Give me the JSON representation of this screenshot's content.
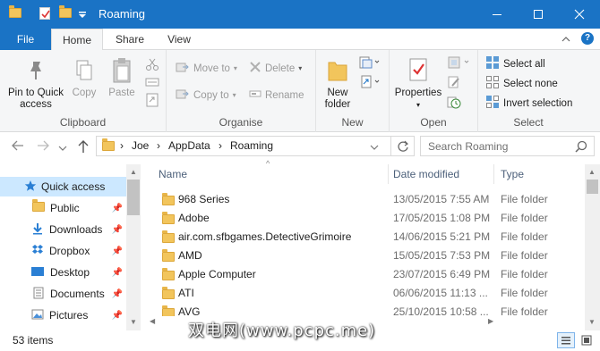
{
  "window": {
    "title": "Roaming"
  },
  "ribbon_tabs": [
    "File",
    "Home",
    "Share",
    "View"
  ],
  "clipboard": {
    "pin_label": "Pin to Quick access",
    "copy_label": "Copy",
    "paste_label": "Paste",
    "group_label": "Clipboard"
  },
  "organise": {
    "move_to": "Move to",
    "copy_to": "Copy to",
    "delete": "Delete",
    "rename": "Rename",
    "group_label": "Organise"
  },
  "new_group": {
    "new_folder": "New folder",
    "group_label": "New"
  },
  "open_group": {
    "properties": "Properties",
    "group_label": "Open"
  },
  "select_group": {
    "select_all": "Select all",
    "select_none": "Select none",
    "invert": "Invert selection",
    "group_label": "Select"
  },
  "address": {
    "crumbs": [
      "Joe",
      "AppData",
      "Roaming"
    ],
    "search_placeholder": "Search Roaming"
  },
  "sidebar": {
    "items": [
      {
        "label": "Quick access",
        "icon": "star-icon",
        "pinned": false
      },
      {
        "label": "Public",
        "icon": "folder-icon",
        "pinned": true
      },
      {
        "label": "Downloads",
        "icon": "download-icon",
        "pinned": true
      },
      {
        "label": "Dropbox",
        "icon": "dropbox-icon",
        "pinned": true
      },
      {
        "label": "Desktop",
        "icon": "desktop-icon",
        "pinned": true
      },
      {
        "label": "Documents",
        "icon": "documents-icon",
        "pinned": true
      },
      {
        "label": "Pictures",
        "icon": "pictures-icon",
        "pinned": true
      }
    ]
  },
  "file_list": {
    "columns": [
      "Name",
      "Date modified",
      "Type"
    ],
    "rows": [
      {
        "name": "968 Series",
        "date": "13/05/2015 7:55 AM",
        "type": "File folder"
      },
      {
        "name": "Adobe",
        "date": "17/05/2015 1:08 PM",
        "type": "File folder"
      },
      {
        "name": "air.com.sfbgames.DetectiveGrimoire",
        "date": "14/06/2015 5:21 PM",
        "type": "File folder"
      },
      {
        "name": "AMD",
        "date": "15/05/2015 7:53 PM",
        "type": "File folder"
      },
      {
        "name": "Apple Computer",
        "date": "23/07/2015 6:49 PM",
        "type": "File folder"
      },
      {
        "name": "ATI",
        "date": "06/06/2015 11:13 ...",
        "type": "File folder"
      },
      {
        "name": "AVG",
        "date": "25/10/2015 10:58 ...",
        "type": "File folder"
      }
    ]
  },
  "status": {
    "items_count": "53 items"
  },
  "watermark": "双电网(www.pcpc.me)",
  "colors": {
    "accent": "#1a73c5",
    "folder": "#f2c55c",
    "selected": "#cce8ff"
  }
}
